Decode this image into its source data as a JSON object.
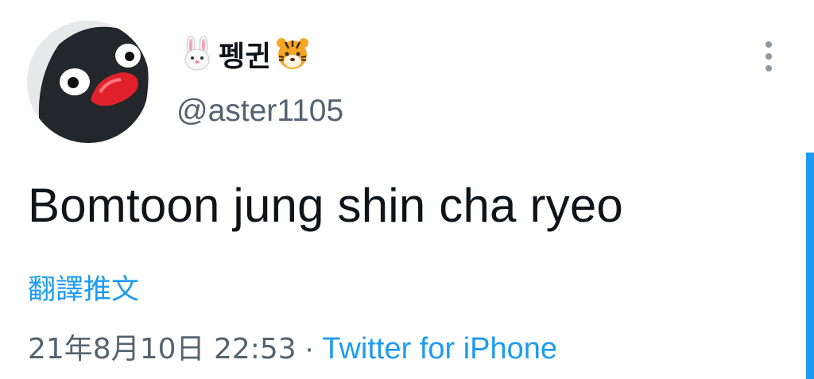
{
  "author": {
    "display_name": "펭귄",
    "handle": "@aster1105",
    "name_emoji_left": "rabbit-face-icon",
    "name_emoji_right": "tiger-face-icon"
  },
  "tweet": {
    "text": "Bomtoon jung shin cha ryeo",
    "translate_label": "翻譯推文",
    "timestamp": "21年8月10日 22:53",
    "separator": "·",
    "source": "Twitter for iPhone"
  },
  "colors": {
    "text_primary": "#0f1419",
    "text_secondary": "#536471",
    "accent": "#1d9bf0"
  }
}
